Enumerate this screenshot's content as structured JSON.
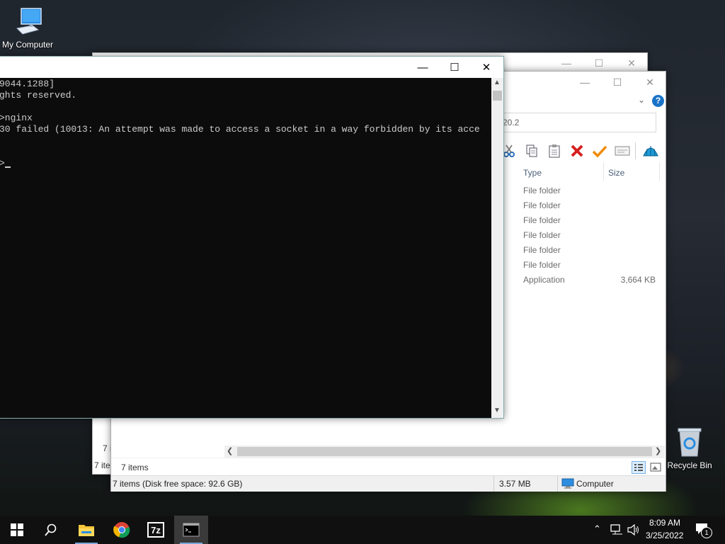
{
  "desktop": {
    "icons": [
      {
        "label": "My Computer"
      },
      {
        "label": "Recycle Bin"
      }
    ]
  },
  "explorer_back": {
    "status": "7 items",
    "status_left": "7 ite"
  },
  "explorer_front": {
    "address_text": "20.2",
    "columns": {
      "type": "Type",
      "size": "Size"
    },
    "rows": [
      {
        "type": "File folder",
        "size": ""
      },
      {
        "type": "File folder",
        "size": ""
      },
      {
        "type": "File folder",
        "size": ""
      },
      {
        "type": "File folder",
        "size": ""
      },
      {
        "type": "File folder",
        "size": ""
      },
      {
        "type": "File folder",
        "size": ""
      },
      {
        "type": "Application",
        "size": "3,664 KB"
      }
    ],
    "items_count": "7 items",
    "status_disk": "7 items (Disk free space: 92.6 GB)",
    "status_size": "3.57 MB",
    "status_location": "Computer"
  },
  "console": {
    "lines": [
      "9044.1288]",
      "ghts reserved.",
      "",
      ">nginx",
      "30 failed (10013: An attempt was made to access a socket in a way forbidden by its acce",
      "",
      "",
      ">"
    ]
  },
  "taskbar": {
    "time": "8:09 AM",
    "date": "3/25/2022",
    "notifications": "1"
  },
  "colors": {
    "console_bg": "#0c0c0c",
    "accent": "#7aa7d8",
    "delete_red": "#d62020",
    "check_orange": "#f08a00"
  }
}
